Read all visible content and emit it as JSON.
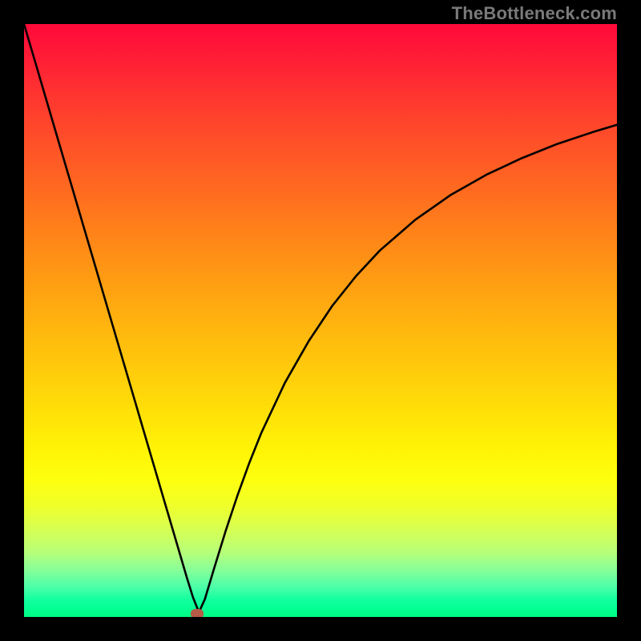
{
  "attribution": "TheBottleneck.com",
  "colors": {
    "frame": "#000000",
    "gradient_top": "#ff0a3a",
    "gradient_bottom": "#00fa80",
    "curve": "#000000",
    "dot": "#b55a46"
  },
  "chart_data": {
    "type": "line",
    "title": "",
    "xlabel": "",
    "ylabel": "",
    "xlim": [
      0,
      100
    ],
    "ylim": [
      0,
      100
    ],
    "grid": false,
    "legend": false,
    "series": [
      {
        "name": "bottleneck-curve",
        "x": [
          0,
          2,
          4,
          6,
          8,
          10,
          12,
          14,
          16,
          18,
          20,
          22,
          24,
          26,
          27.5,
          28.5,
          29.5,
          30.5,
          32,
          34,
          36,
          38,
          40,
          44,
          48,
          52,
          56,
          60,
          66,
          72,
          78,
          84,
          90,
          96,
          100
        ],
        "y": [
          100,
          93.2,
          86.4,
          79.6,
          72.8,
          66.0,
          59.2,
          52.4,
          45.6,
          38.8,
          32.0,
          25.2,
          18.4,
          11.6,
          6.5,
          3.3,
          0.8,
          3.0,
          8.0,
          14.5,
          20.5,
          26.0,
          31.0,
          39.5,
          46.5,
          52.5,
          57.5,
          61.8,
          67.0,
          71.2,
          74.6,
          77.4,
          79.8,
          81.8,
          83.0
        ]
      }
    ],
    "marker": {
      "x": 29.2,
      "y": 0.6
    }
  }
}
